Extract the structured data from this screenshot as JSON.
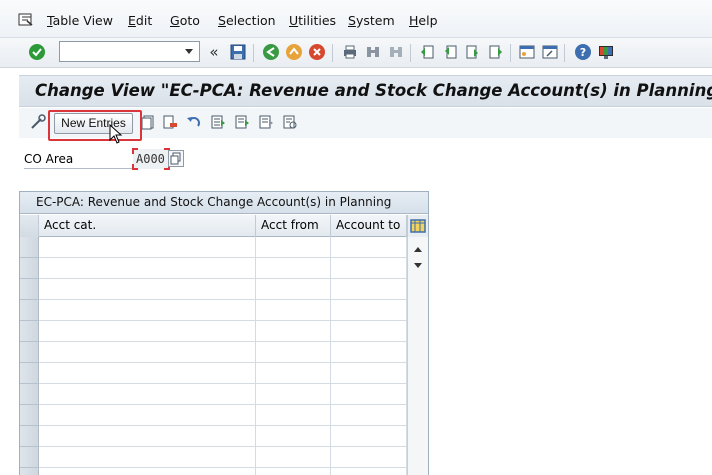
{
  "menu": {
    "items": [
      {
        "label": "Table View"
      },
      {
        "label": "Edit"
      },
      {
        "label": "Goto"
      },
      {
        "label": "Selection"
      },
      {
        "label": "Utilities"
      },
      {
        "label": "System"
      },
      {
        "label": "Help"
      }
    ]
  },
  "toolbar": {
    "command_field_value": "",
    "more_glyph": "«"
  },
  "title": "Change View \"EC-PCA: Revenue and Stock Change Account(s) in Planning\":",
  "app_toolbar": {
    "new_entries_label": "New Entries"
  },
  "co_area": {
    "label": "CO Area",
    "value": "A000"
  },
  "table": {
    "title": "EC-PCA: Revenue and Stock Change Account(s) in Planning",
    "columns": [
      "Acct cat.",
      "Acct from",
      "Account to"
    ],
    "row_count": 12
  },
  "colors": {
    "highlight": "#d9353a",
    "accent_green": "#2d9a3a"
  }
}
